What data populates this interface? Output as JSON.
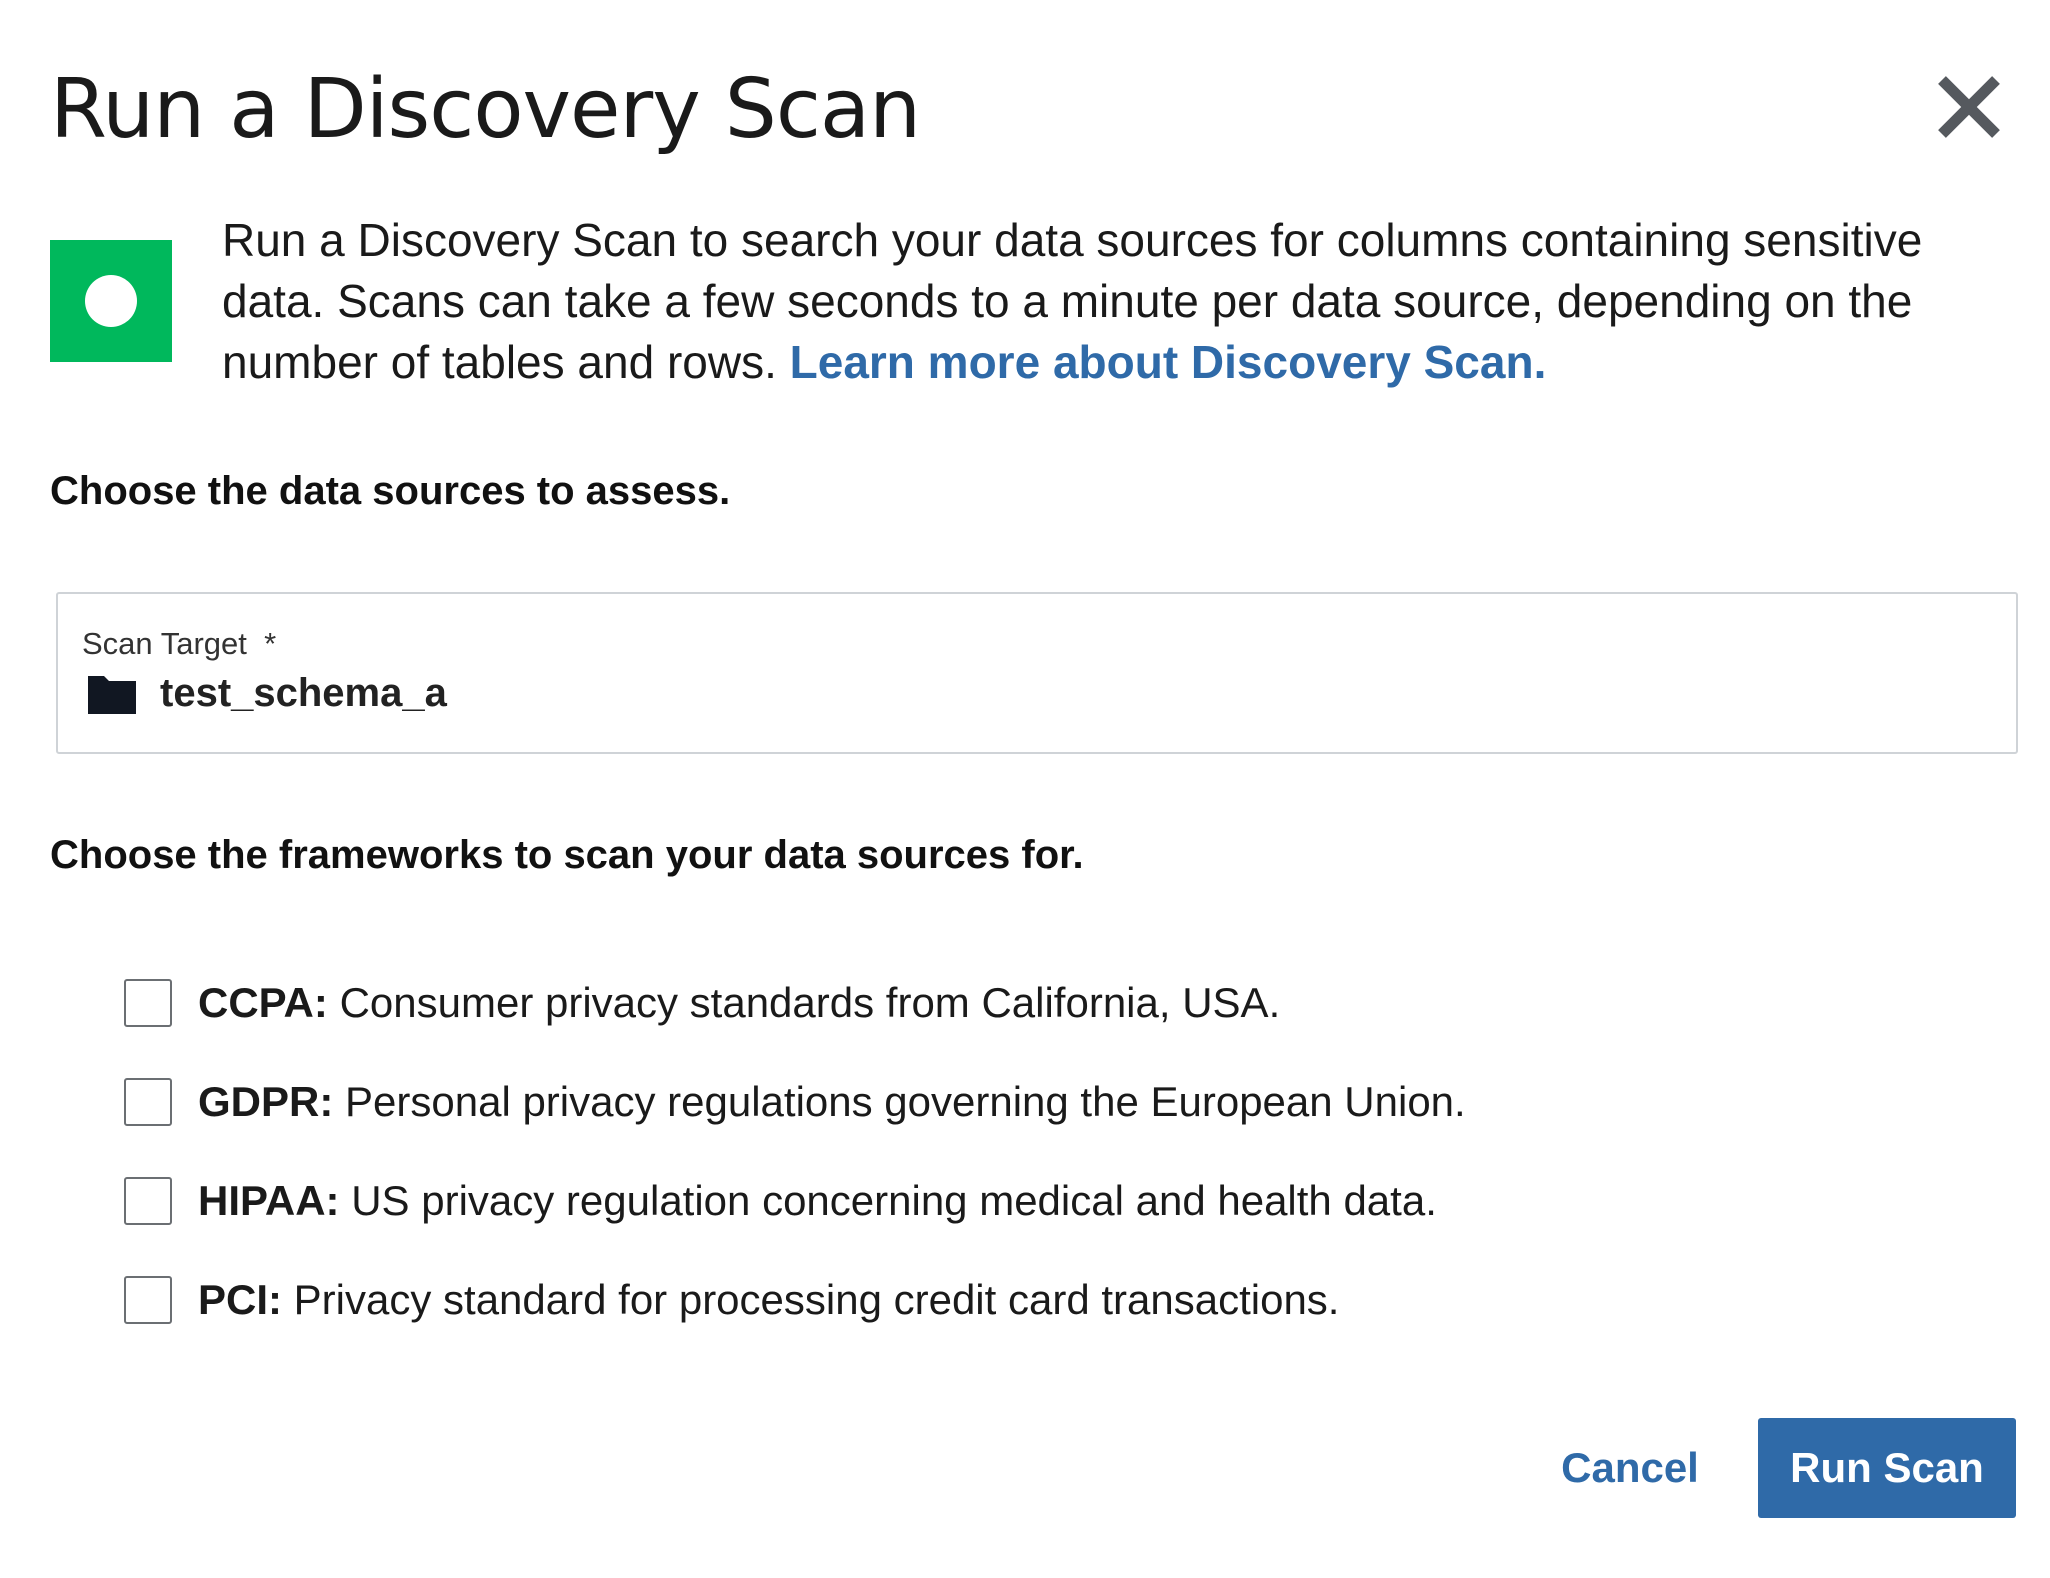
{
  "dialog": {
    "title": "Run a Discovery Scan",
    "close_icon": "close-icon"
  },
  "info": {
    "icon": "status-indicator-icon",
    "icon_color": "#00b85c",
    "text": "Run a Discovery Scan to search your data sources for columns containing sensitive data. Scans can take a few seconds to a minute per data source, depending on the number of tables and rows.",
    "link_text": "Learn more about Discovery Scan."
  },
  "sources": {
    "heading": "Choose the data sources to assess.",
    "scan_target": {
      "label": "Scan Target",
      "required_marker": "*",
      "icon": "folder-icon",
      "value": "test_schema_a"
    }
  },
  "frameworks": {
    "heading": "Choose the frameworks to scan your data sources for.",
    "items": [
      {
        "name": "CCPA:",
        "description": "Consumer privacy standards from California, USA.",
        "checked": false
      },
      {
        "name": "GDPR:",
        "description": "Personal privacy regulations governing the European Union.",
        "checked": false
      },
      {
        "name": "HIPAA:",
        "description": "US privacy regulation concerning medical and health data.",
        "checked": false
      },
      {
        "name": "PCI:",
        "description": "Privacy standard for processing credit card transactions.",
        "checked": false
      }
    ]
  },
  "footer": {
    "cancel_label": "Cancel",
    "run_label": "Run Scan"
  },
  "colors": {
    "accent": "#2f6aa8",
    "success": "#00b85c"
  }
}
